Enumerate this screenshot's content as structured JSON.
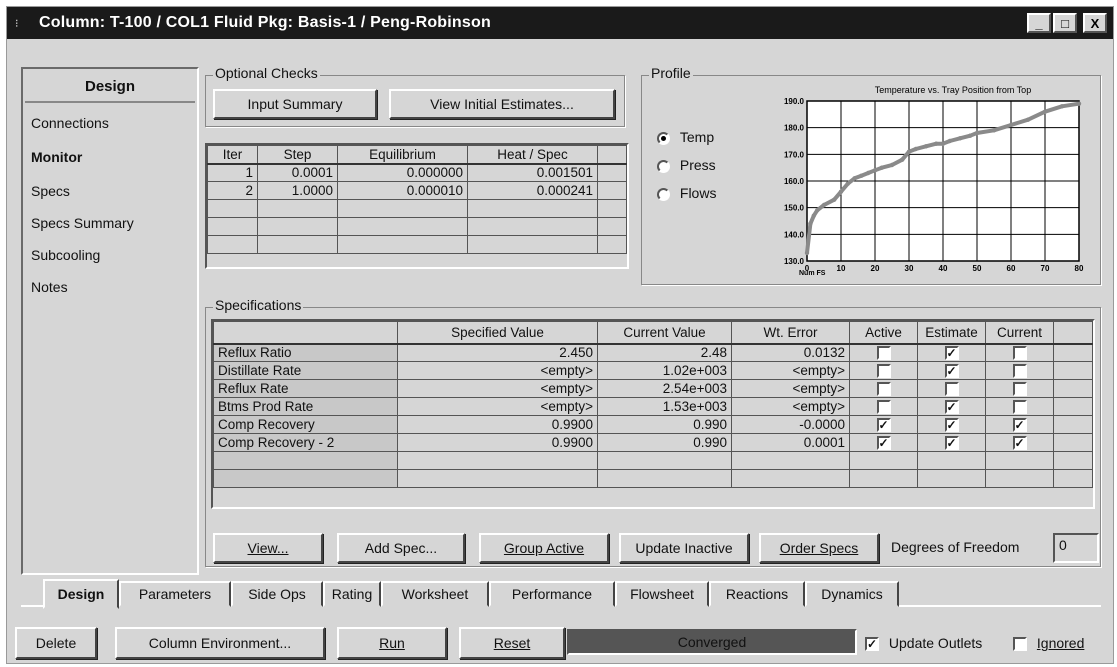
{
  "window": {
    "title": "Column: T-100 / COL1  Fluid Pkg: Basis-1 / Peng-Robinson",
    "min_glyph": "_",
    "max_glyph": "□",
    "close_glyph": "X"
  },
  "nav": {
    "header": "Design",
    "items": [
      {
        "label": "Connections"
      },
      {
        "label": "Monitor"
      },
      {
        "label": "Specs"
      },
      {
        "label": "Specs Summary"
      },
      {
        "label": "Subcooling"
      },
      {
        "label": "Notes"
      }
    ],
    "selected": "Monitor"
  },
  "optional_checks": {
    "label": "Optional Checks",
    "input_summary": "Input Summary",
    "view_initial_estimates": "View Initial Estimates..."
  },
  "iterations": {
    "columns": [
      "Iter",
      "Step",
      "Equilibrium",
      "Heat / Spec"
    ],
    "rows": [
      [
        "1",
        "0.0001",
        "0.000000",
        "0.001501"
      ],
      [
        "2",
        "1.0000",
        "0.000010",
        "0.000241"
      ]
    ]
  },
  "profile": {
    "label": "Profile",
    "options": [
      "Temp",
      "Press",
      "Flows"
    ],
    "selected": "Temp",
    "chart_data": {
      "type": "line",
      "title": "Temperature vs. Tray Position from Top",
      "xlabel": "Num FS",
      "ylabel": "",
      "x_ticks": [
        "0",
        "10",
        "20",
        "30",
        "40",
        "50",
        "60",
        "70",
        "80"
      ],
      "y_ticks": [
        "130.0",
        "140.0",
        "150.0",
        "160.0",
        "170.0",
        "180.0",
        "190.0"
      ],
      "xlim": [
        0,
        80
      ],
      "ylim": [
        130,
        190
      ],
      "grid": true,
      "series_color": "#8a8a8a",
      "x": [
        0,
        1,
        2,
        3,
        5,
        8,
        10,
        12,
        14,
        16,
        18,
        20,
        22,
        25,
        28,
        30,
        32,
        35,
        38,
        40,
        42,
        45,
        48,
        50,
        55,
        60,
        65,
        70,
        75,
        80
      ],
      "y": [
        133,
        144,
        147,
        149,
        151,
        153,
        156,
        159,
        161,
        162,
        163,
        164,
        165,
        166,
        168,
        171,
        172,
        173,
        174,
        174,
        175,
        176,
        177,
        178,
        179,
        181,
        183,
        186,
        188,
        189
      ]
    }
  },
  "specifications": {
    "label": "Specifications",
    "columns": [
      "",
      "Specified Value",
      "Current Value",
      "Wt. Error",
      "Active",
      "Estimate",
      "Current"
    ],
    "rows": [
      {
        "name": "Reflux Ratio",
        "specified": "2.450",
        "current": "2.48",
        "wt_error": "0.0132",
        "active": false,
        "estimate": true,
        "current_chk": false
      },
      {
        "name": "Distillate Rate",
        "specified": "<empty>",
        "current": "1.02e+003",
        "wt_error": "<empty>",
        "active": false,
        "estimate": true,
        "current_chk": false
      },
      {
        "name": "Reflux Rate",
        "specified": "<empty>",
        "current": "2.54e+003",
        "wt_error": "<empty>",
        "active": false,
        "estimate": false,
        "current_chk": false
      },
      {
        "name": "Btms Prod Rate",
        "specified": "<empty>",
        "current": "1.53e+003",
        "wt_error": "<empty>",
        "active": false,
        "estimate": true,
        "current_chk": false
      },
      {
        "name": "Comp Recovery",
        "specified": "0.9900",
        "current": "0.990",
        "wt_error": "-0.0000",
        "active": true,
        "estimate": true,
        "current_chk": true
      },
      {
        "name": "Comp Recovery - 2",
        "specified": "0.9900",
        "current": "0.990",
        "wt_error": "0.0001",
        "active": true,
        "estimate": true,
        "current_chk": true
      }
    ],
    "buttons": {
      "view": "View...",
      "add_spec": "Add Spec...",
      "group_active": "Group Active",
      "update_inactive": "Update Inactive",
      "order_specs": "Order Specs"
    },
    "dof_label": "Degrees of Freedom",
    "dof_value": "0"
  },
  "tabs": [
    "Design",
    "Parameters",
    "Side Ops",
    "Rating",
    "Worksheet",
    "Performance",
    "Flowsheet",
    "Reactions",
    "Dynamics"
  ],
  "active_tab": "Design",
  "footer": {
    "delete": "Delete",
    "column_environment": "Column Environment...",
    "run": "Run",
    "reset": "Reset",
    "status": "Converged",
    "status_color": "#555555",
    "update_outlets": "Update Outlets",
    "update_outlets_checked": true,
    "ignored": "Ignored",
    "ignored_checked": false
  },
  "check_glyph": "✓"
}
